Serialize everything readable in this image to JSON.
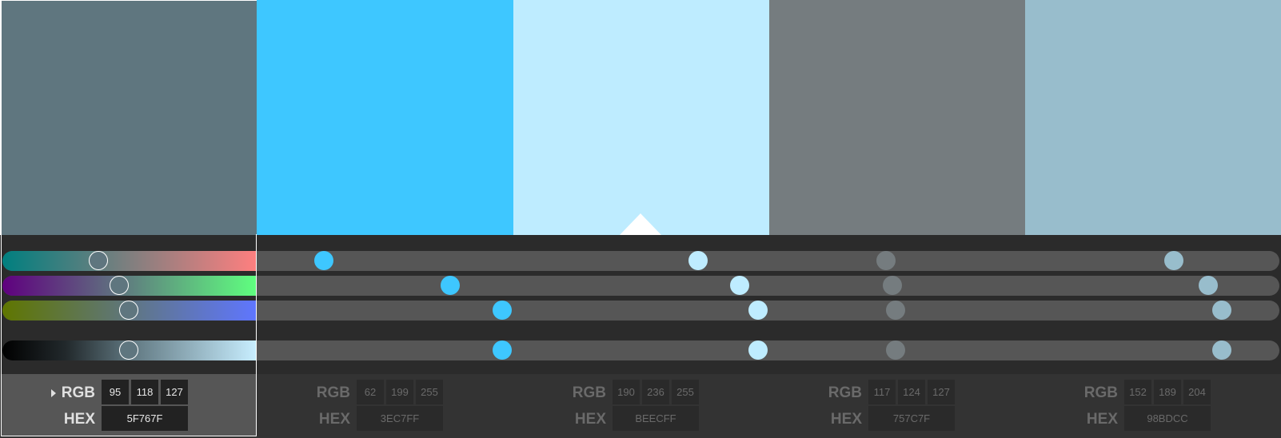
{
  "swatches": [
    {
      "hex_label": "5F767F",
      "rgb": [
        "95",
        "118",
        "127"
      ],
      "color": "#5f767f",
      "active": true
    },
    {
      "hex_label": "3EC7FF",
      "rgb": [
        "62",
        "199",
        "255"
      ],
      "color": "#3ec7ff",
      "active": false
    },
    {
      "hex_label": "BEECFF",
      "rgb": [
        "190",
        "236",
        "255"
      ],
      "color": "#beecff",
      "active": false
    },
    {
      "hex_label": "757C7F",
      "rgb": [
        "117",
        "124",
        "127"
      ],
      "color": "#757c7f",
      "active": false
    },
    {
      "hex_label": "98BDCC",
      "rgb": [
        "152",
        "189",
        "204"
      ],
      "color": "#98bdcc",
      "active": false
    }
  ],
  "labels": {
    "rgb": "RGB",
    "hex": "HEX"
  },
  "slider_channels": [
    "red",
    "green",
    "blue",
    "brightness"
  ],
  "colors": {
    "background": "#2d2d2d",
    "track": "#565656",
    "active_panel": "#565656",
    "inactive_panel": "#333333"
  },
  "icons": {
    "expand": "triangle-right-icon",
    "selection": "caret-up-icon"
  }
}
